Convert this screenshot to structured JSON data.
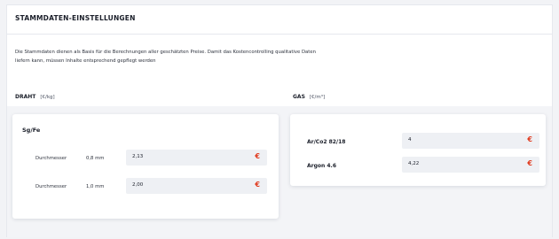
{
  "panel": {
    "title": "STAMMDATEN-EINSTELLUNGEN",
    "description_line1": "Die Stammdaten dienen als Basis für die Berechnungen aller geschätzten Preise. Damit das Kostencontrolling qualitative Daten",
    "description_line2": "liefern kann, müssen Inhalte entsprechend gepflegt werden"
  },
  "draht": {
    "label": "DRAHT",
    "unit": "[€/kg]",
    "card_title": "Sg/Fe",
    "rows": [
      {
        "label": "Durchmesser",
        "size": "0,8 mm",
        "value": "2,13",
        "currency": "€"
      },
      {
        "label": "Durchmesser",
        "size": "1,0 mm",
        "value": "2,00",
        "currency": "€"
      }
    ]
  },
  "gas": {
    "label": "GAS",
    "unit": "[€/m³]",
    "rows": [
      {
        "name": "Ar/Co2 82/18",
        "value": "4",
        "currency": "€"
      },
      {
        "name": "Argon 4.6",
        "value": "4,22",
        "currency": "€"
      }
    ]
  },
  "colors": {
    "accent": "#e03a1e",
    "background": "#f2f3f6",
    "card": "#ffffff",
    "input": "#eef0f4"
  }
}
